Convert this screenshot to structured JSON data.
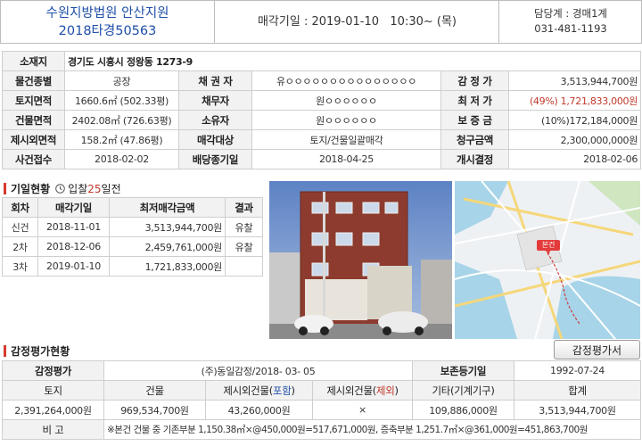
{
  "header": {
    "court": "수원지방법원 안산지원",
    "case_no": "2018타경50563",
    "sale_date_label": "매각기일",
    "sale_date": ": 2019-01-10   10:30~ (목)",
    "dept": "담당계 : 경매1계",
    "phone": "031-481-1193"
  },
  "info": {
    "address_label": "소재지",
    "address": "경기도 시흥시 정왕동 1273-9",
    "rows": [
      [
        "물건종별",
        "공장",
        "채 권 자",
        "유ㅇㅇㅇㅇㅇㅇㅇㅇㅇㅇㅇㅇㅇㅇㅇ",
        "감 정 가",
        "3,513,944,700원"
      ],
      [
        "토지면적",
        "1660.6㎡ (502.33평)",
        "채무자",
        "원ㅇㅇㅇㅇㅇㅇ",
        "최 저 가",
        "(49%) 1,721,833,000원"
      ],
      [
        "건물면적",
        "2402.08㎡ (726.63평)",
        "소유자",
        "원ㅇㅇㅇㅇㅇㅇ",
        "보 증 금",
        "(10%)172,184,000원"
      ],
      [
        "제시외면적",
        "158.2㎡ (47.86평)",
        "매각대상",
        "토지/건물일괄매각",
        "청구금액",
        "2,300,000,000원"
      ],
      [
        "사건접수",
        "2018-02-02",
        "배당종기일",
        "2018-04-25",
        "개시결정",
        "2018-02-06"
      ]
    ]
  },
  "history": {
    "title": "기일현황",
    "bid_prefix": "입찰",
    "bid_days": "25",
    "bid_suffix": "일전",
    "headers": [
      "회차",
      "매각기일",
      "최저매각금액",
      "결과"
    ],
    "rows": [
      [
        "신건",
        "2018-11-01",
        "3,513,944,700원",
        "유찰"
      ],
      [
        "2차",
        "2018-12-06",
        "2,459,761,000원",
        "유찰"
      ],
      [
        "3차",
        "2019-01-10",
        "1,721,833,000원",
        ""
      ]
    ]
  },
  "map": {
    "pin_label": "본건"
  },
  "appraisal": {
    "title": "감정평가현황",
    "button": "감정평가서",
    "row1": [
      "감정평가",
      "(주)동일감정/2018- 03- 05",
      "보존등기일",
      "1992-07-24"
    ],
    "headers": [
      "토지",
      "건물",
      "제시외건물(",
      "포함",
      ")",
      "제시외건물(",
      "제외",
      ")",
      "기타(기계기구)",
      "합계"
    ],
    "values": [
      "2,391,264,000원",
      "969,534,700원",
      "43,260,000원",
      "×",
      "109,886,000원",
      "3,513,944,700원"
    ],
    "note_label": "비 고",
    "note": "※본건 건물 중 기존부분 1,150.38㎡×@450,000원=517,671,000원, 증축부분 1,251.7㎡×@361,000원=451,863,700원"
  },
  "colors": {
    "accent_blue": "#1f4fa8",
    "accent_red": "#c0392b",
    "label_bg": "#f2f2f2"
  }
}
